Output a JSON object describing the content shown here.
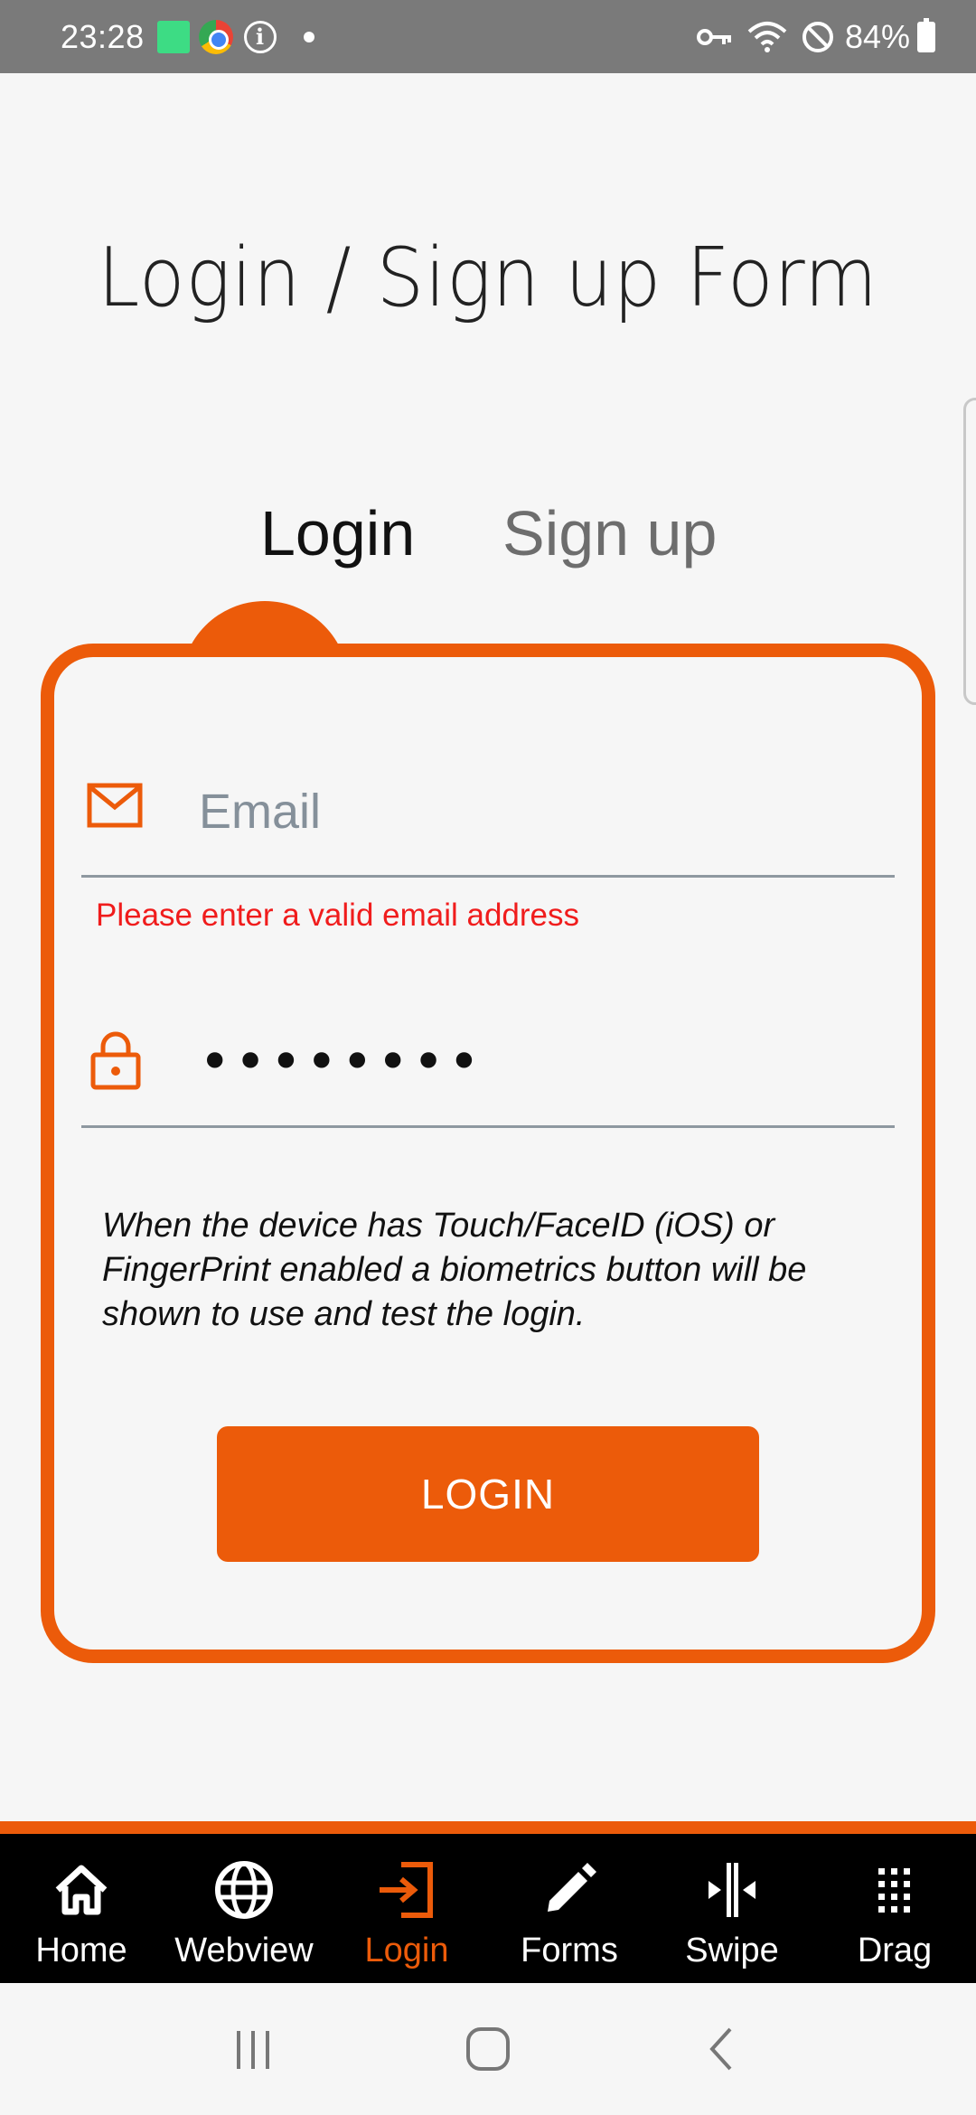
{
  "status_bar": {
    "time": "23:28",
    "battery": "84%"
  },
  "page": {
    "title": "Login / Sign up Form"
  },
  "tabs": [
    {
      "label": "Login",
      "active": true
    },
    {
      "label": "Sign up",
      "active": false
    }
  ],
  "form": {
    "email_placeholder": "Email",
    "email_value": "",
    "email_error": "Please enter a valid email address",
    "password_value": "••••••••",
    "help_text": "When the device has Touch/FaceID (iOS) or FingerPrint enabled a biometrics button will be shown to use and test the login.",
    "submit_label": "LOGIN"
  },
  "bottom_nav": {
    "items": [
      {
        "label": "Home",
        "icon": "home-icon"
      },
      {
        "label": "Webview",
        "icon": "globe-icon"
      },
      {
        "label": "Login",
        "icon": "login-icon",
        "active": true
      },
      {
        "label": "Forms",
        "icon": "pencil-icon"
      },
      {
        "label": "Swipe",
        "icon": "swipe-icon"
      },
      {
        "label": "Drag",
        "icon": "grid-icon"
      }
    ]
  },
  "colors": {
    "accent": "#ec5b0a",
    "error": "#f01c1c",
    "status_bar": "#7a7a7a",
    "tab_bar": "#000000"
  }
}
